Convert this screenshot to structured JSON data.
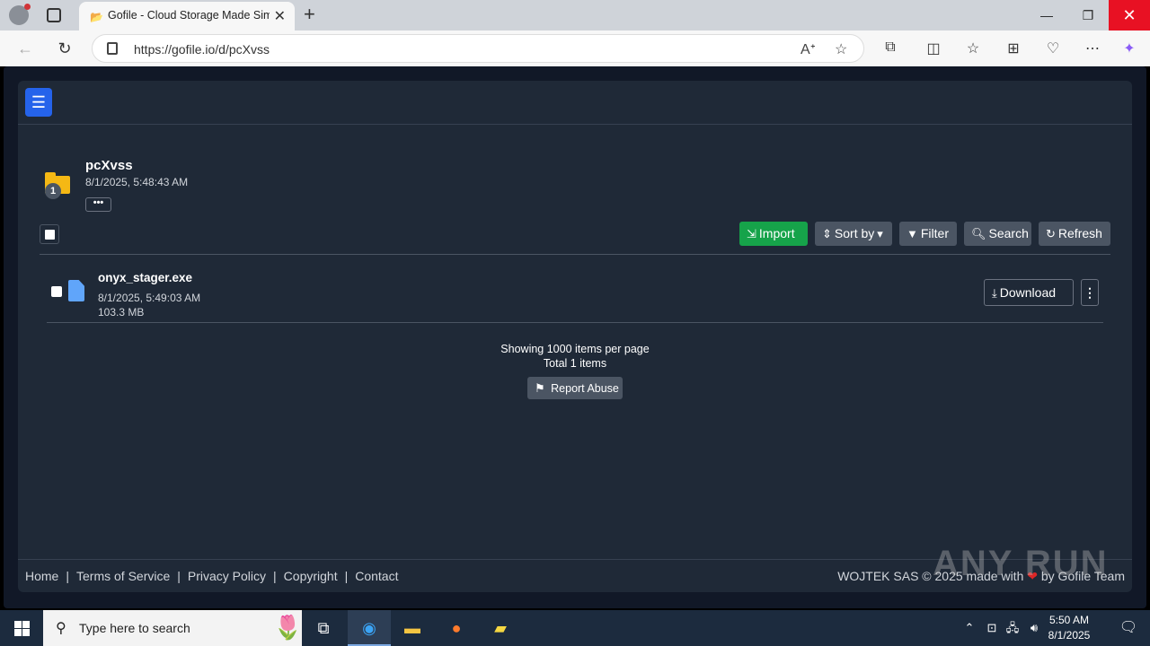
{
  "browser": {
    "tab_title": "Gofile - Cloud Storage Made Simp",
    "tab_favicon": "folder-favicon",
    "url": "https://gofile.io/d/pcXvss",
    "icons": [
      "read-aloud-icon",
      "favorite-star-icon",
      "extensions-icon",
      "split-screen-icon",
      "favorites-icon",
      "collections-icon",
      "browser-essentials-icon",
      "more-icon",
      "copilot-icon"
    ]
  },
  "folder": {
    "name": "pcXvss",
    "date": "8/1/2025, 5:48:43 AM",
    "count": "1",
    "more_label": "•••"
  },
  "toolbar": {
    "import": "Import",
    "sort": "Sort by",
    "filter": "Filter",
    "search": "Search",
    "refresh": "Refresh"
  },
  "files": [
    {
      "name": "onyx_stager.exe",
      "date": "8/1/2025, 5:49:03 AM",
      "size": "103.3 MB",
      "download_label": "Download"
    }
  ],
  "paging": {
    "per_page": "Showing 1000 items per page",
    "total": "Total 1 items",
    "report": "Report Abuse"
  },
  "footer": {
    "links": [
      "Home",
      "Terms of Service",
      "Privacy Policy",
      "Copyright",
      "Contact"
    ],
    "credit_prefix": "WOJTEK SAS © 2025 made with",
    "credit_suffix": "by Gofile Team",
    "watermark": "ANY RUN"
  },
  "taskbar": {
    "search_placeholder": "Type here to search",
    "time": "5:50 AM",
    "date": "8/1/2025"
  },
  "colors": {
    "accent_blue": "#2563eb",
    "import_green": "#16a34a",
    "page_bg": "#1f2937"
  }
}
